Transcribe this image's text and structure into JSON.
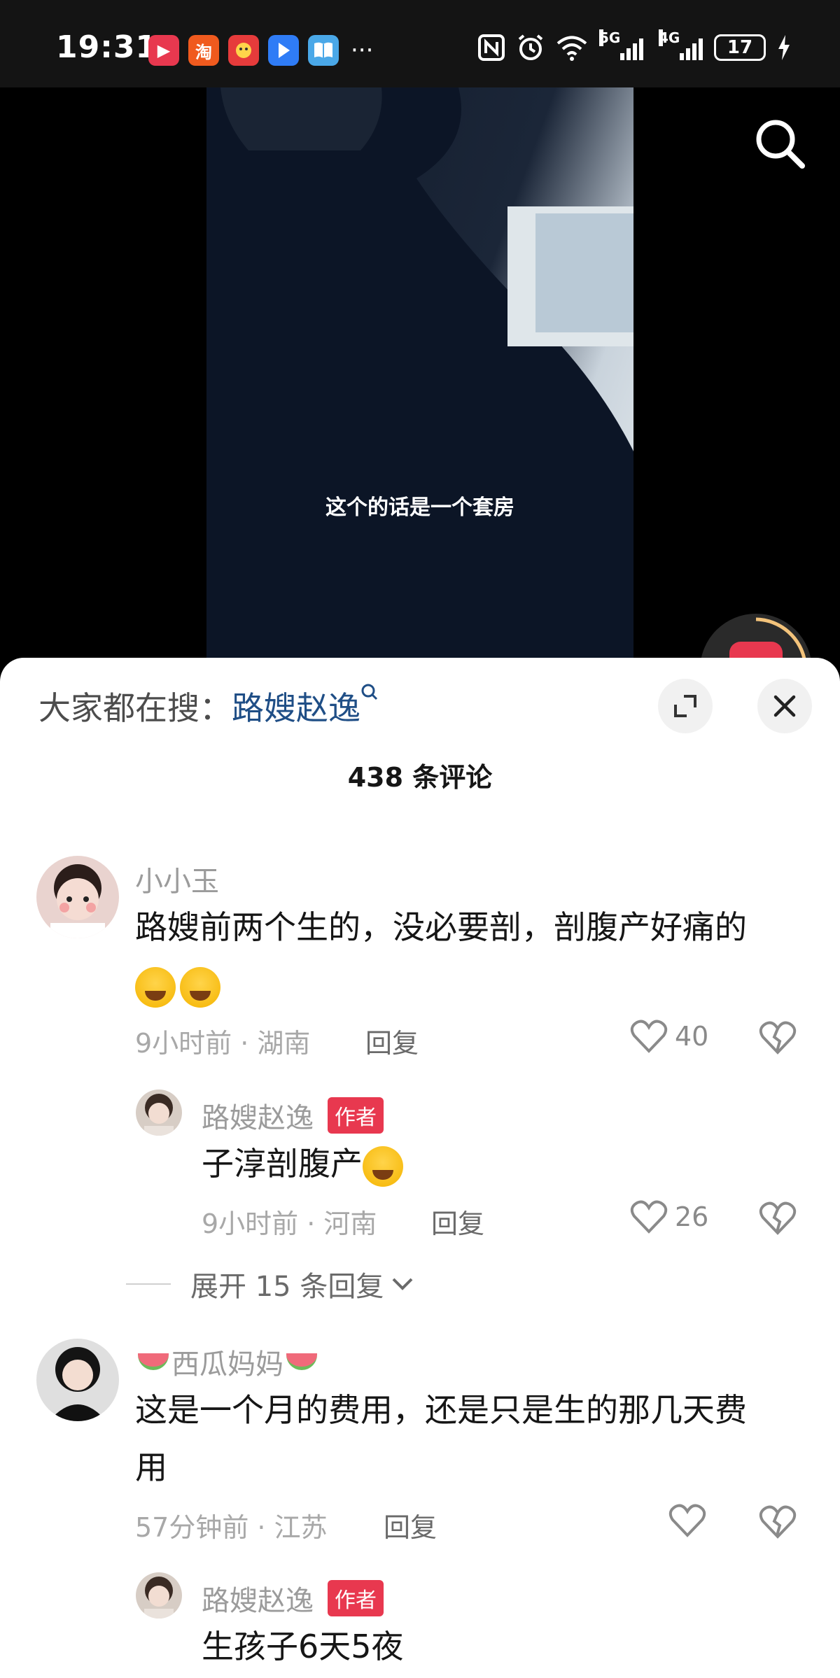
{
  "status_bar": {
    "time": "19:31",
    "network_5g": "5G",
    "network_4g": "4G",
    "battery": "17",
    "app_icons": [
      {
        "name": "video-app-icon",
        "glyph": "▶",
        "color": "#e8384f"
      },
      {
        "name": "taobao-icon",
        "glyph": "淘",
        "color": "#f05a1e"
      },
      {
        "name": "game-app-icon",
        "glyph": "",
        "color": "#e63b3b"
      },
      {
        "name": "bluetooth-share-icon",
        "glyph": "",
        "color": "#2f7cf6"
      },
      {
        "name": "book-app-icon",
        "glyph": "",
        "color": "#4aa8e8"
      }
    ]
  },
  "video": {
    "subtitle": "这个的话是一个套房"
  },
  "comments_panel": {
    "hot_search_prefix": "大家都在搜：",
    "hot_search_term": "路嫂赵逸",
    "comment_count": "438 条评论",
    "comments": [
      {
        "username": "小小玉",
        "text_line1": "路嫂前两个生的，没必要剖，剖腹产好痛的",
        "time": "9小时前 · 湖南",
        "reply": "回复",
        "likes": "40",
        "emojis": [
          "crying-face",
          "crying-face"
        ],
        "replies": [
          {
            "username": "路嫂赵逸",
            "tag": "作者",
            "text": "子淳剖腹产",
            "time": "9小时前 · 河南",
            "reply": "回复",
            "likes": "26"
          }
        ],
        "expand": "展开 15 条回复"
      },
      {
        "username": "西瓜妈妈",
        "text_line1": "这是一个月的费用，还是只是生的那几天费",
        "text_line2": "用",
        "time": "57分钟前 · 江苏",
        "reply": "回复",
        "likes": "",
        "replies": [
          {
            "username": "路嫂赵逸",
            "tag": "作者",
            "text": "生孩子6天5夜"
          }
        ]
      }
    ]
  },
  "colors": {
    "accent_red": "#e8384f",
    "link_blue": "#1f4e86"
  }
}
